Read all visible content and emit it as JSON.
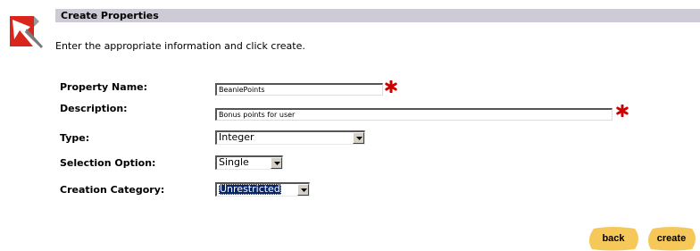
{
  "header": {
    "title": "Create Properties",
    "logo_icon": "red-white-tools-logo"
  },
  "instructions": "Enter the appropriate information and click create.",
  "form": {
    "property_name": {
      "label": "Property Name:",
      "value": "BeaniePoints",
      "required": true
    },
    "description": {
      "label": "Description:",
      "value": "Bonus points for user",
      "required": true
    },
    "type": {
      "label": "Type:",
      "selected": "Integer"
    },
    "selection_option": {
      "label": "Selection Option:",
      "selected": "Single"
    },
    "creation_category": {
      "label": "Creation Category:",
      "selected": "Unrestricted"
    }
  },
  "buttons": {
    "back": "back",
    "create": "create"
  },
  "colors": {
    "title_bar": "#cfcbd6",
    "required_star": "#cc0000",
    "button_fill": "#f6c85a",
    "selection_highlight": "#0a246a"
  }
}
